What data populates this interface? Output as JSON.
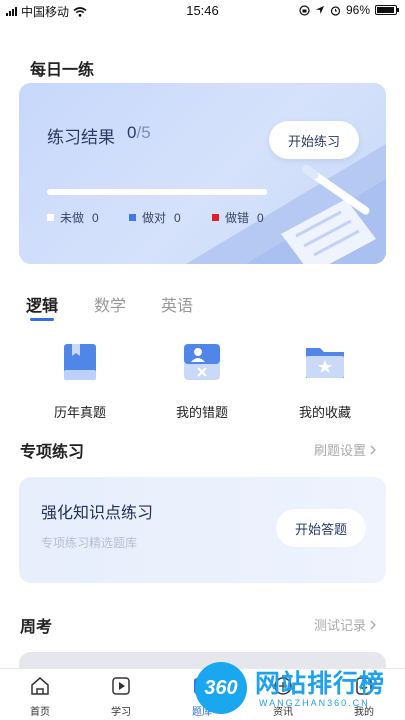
{
  "status_bar": {
    "carrier": "中国移动",
    "time": "15:46",
    "battery": "96%",
    "battery_level": 0.96
  },
  "daily": {
    "title": "每日一练",
    "result_label": "练习结果",
    "done": "0",
    "total": "/5",
    "progress": 0,
    "start_label": "开始练习",
    "legend": [
      {
        "label": "未做",
        "value": "0",
        "color": "#ffffff"
      },
      {
        "label": "做对",
        "value": "0",
        "color": "#3f7be6"
      },
      {
        "label": "做错",
        "value": "0",
        "color": "#e02020"
      }
    ]
  },
  "subject_tabs": [
    "逻辑",
    "数学",
    "英语"
  ],
  "quick_links": [
    "历年真题",
    "我的错题",
    "我的收藏"
  ],
  "special": {
    "title": "专项练习",
    "settings_link": "刷题设置",
    "card_title": "强化知识点练习",
    "card_subtitle": "专项练习精选题库",
    "answer_label": "开始答题"
  },
  "weekly": {
    "title": "周考",
    "records_link": "测试记录"
  },
  "tabbar": [
    "首页",
    "学习",
    "题库",
    "资讯",
    "我的"
  ],
  "watermark": {
    "badge": "360",
    "text": "网站排行榜",
    "domain": "WANGZHAN360.CN"
  },
  "colors": {
    "accent": "#2f6fe8",
    "card_bg": "#d0defb"
  }
}
